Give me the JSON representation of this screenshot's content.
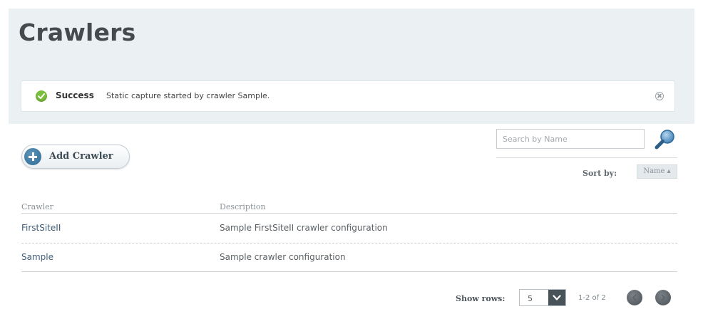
{
  "header": {
    "title": "Crawlers"
  },
  "alert": {
    "title": "Success",
    "message": "Static capture started by crawler Sample.",
    "status_color": "#7bbd3c"
  },
  "toolbar": {
    "add_label": "Add Crawler",
    "search_placeholder": "Search by Name",
    "search_value": "",
    "sort_label": "Sort by:",
    "sort_value": "Name ▴"
  },
  "table": {
    "columns": [
      "Crawler",
      "Description"
    ],
    "rows": [
      {
        "name": "FirstSiteII",
        "description": "Sample FirstSiteII crawler configuration"
      },
      {
        "name": "Sample",
        "description": "Sample crawler configuration"
      }
    ]
  },
  "pagination": {
    "show_rows_label": "Show rows:",
    "rows_value": "5",
    "range": "1-2 of 2"
  },
  "icons": {
    "success": "check-circle-icon",
    "close": "close-circle-icon",
    "add": "plus-circle-icon",
    "search": "magnifier-icon",
    "dropdown": "chevron-down-icon",
    "prev": "chevron-left-icon",
    "next": "chevron-right-icon"
  },
  "colors": {
    "header_bg": "#ebf0f3",
    "accent": "#2c6a94"
  }
}
